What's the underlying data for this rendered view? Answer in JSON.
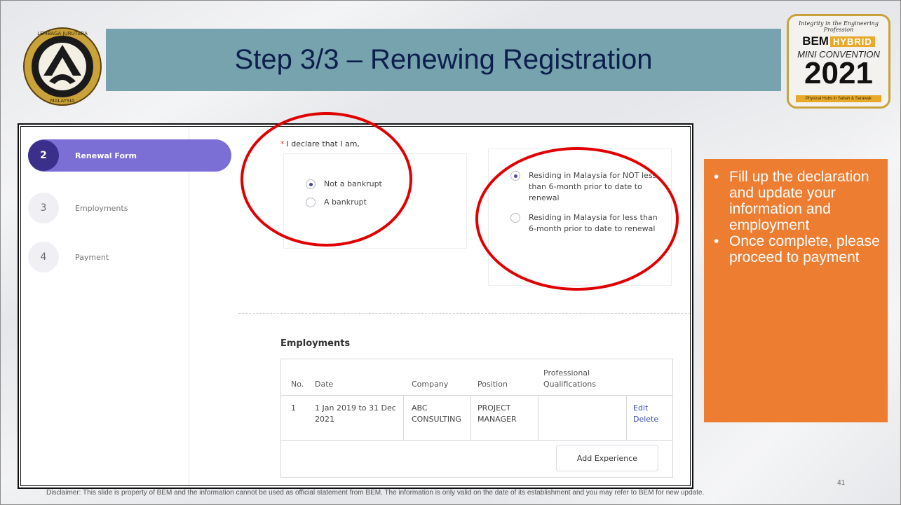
{
  "slide": {
    "title": "Step 3/3 – Renewing Registration",
    "page_number": "41",
    "disclaimer": "Disclaimer: This slide is property of BEM and the information cannot be used as official statement from BEM. The information is only valid on the date of its establishment and you may refer to BEM for new update."
  },
  "logo_left": {
    "icon": "lembaga-jurutera-malaysia-seal",
    "text_top": "LEMBAGA JURUTERA",
    "text_bottom": "MALAYSIA"
  },
  "logo_right": {
    "icon": "bem-hybrid-mini-convention-logo",
    "tagline": "Integrity in the Engineering Profession",
    "brand": "BEM",
    "hybrid": "HYBRID",
    "event": "MINI CONVENTION",
    "year": "2021",
    "footer": "Physical Hubs in Sabah & Sarawak"
  },
  "sidebar": {
    "steps": [
      {
        "number": "2",
        "label": "Renewal Form",
        "active": true
      },
      {
        "number": "3",
        "label": "Employments",
        "active": false
      },
      {
        "number": "4",
        "label": "Payment",
        "active": false
      }
    ]
  },
  "declaration": {
    "required_mark": "*",
    "label": "I declare that I am,",
    "bankruptcy_options": [
      {
        "label": "Not a bankrupt",
        "checked": true
      },
      {
        "label": "A bankrupt",
        "checked": false
      }
    ],
    "residency_options": [
      {
        "label": "Residing in Malaysia for NOT less than 6-month prior to date to renewal",
        "checked": true
      },
      {
        "label": "Residing in Malaysia for less than 6-month prior to date to renewal",
        "checked": false
      }
    ]
  },
  "employments": {
    "title": "Employments",
    "headers": [
      "No.",
      "Date",
      "Company",
      "Position",
      "Professional Qualifications"
    ],
    "rows": [
      {
        "no": "1",
        "date": "1 Jan 2019 to 31 Dec 2021",
        "company": "ABC CONSULTING",
        "position": "PROJECT MANAGER",
        "qualifications": "",
        "edit": "Edit",
        "delete": "Delete"
      }
    ],
    "add_button": "Add Experience"
  },
  "instructions": {
    "items": [
      "Fill up the declaration and update your information and employment",
      "Once complete, please proceed to payment"
    ]
  },
  "colors": {
    "title_bar": "#76a3ad",
    "title_text": "#0d1f4d",
    "active_step": "#7b6fd6",
    "annotation_circle": "#e00000",
    "instruction_box": "#ed7d31"
  }
}
